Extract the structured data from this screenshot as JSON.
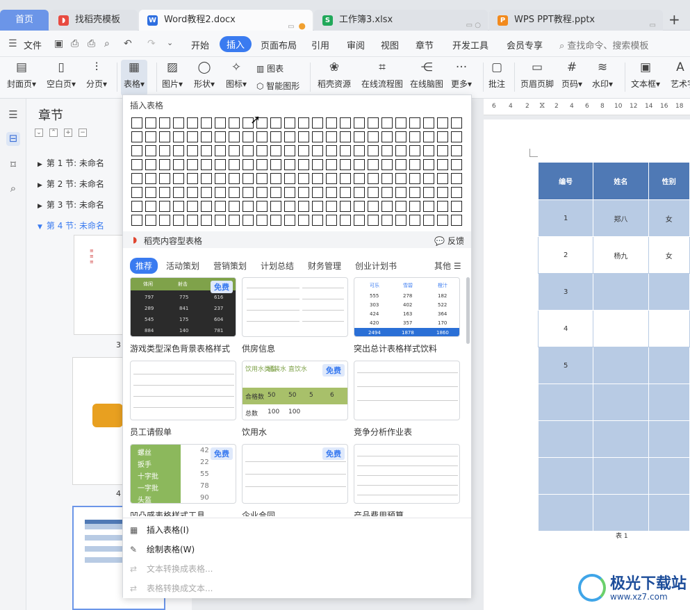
{
  "tabs": {
    "home": "首页",
    "items": [
      {
        "label": "找稻壳模板",
        "icon": "docer-icon"
      },
      {
        "label": "Word教程2.docx",
        "icon": "word-icon"
      },
      {
        "label": "工作簿3.xlsx",
        "icon": "sheet-icon"
      },
      {
        "label": "WPS PPT教程.pptx",
        "icon": "ppt-icon"
      }
    ],
    "new_tab": "+"
  },
  "menu": {
    "file": "文件",
    "items": [
      "开始",
      "插入",
      "页面布局",
      "引用",
      "审阅",
      "视图",
      "章节",
      "开发工具",
      "会员专享"
    ],
    "active": "插入",
    "search": "查找命令、搜索模板"
  },
  "ribbon": {
    "cover": "封面页",
    "blank": "空白页",
    "pagebreak": "分页",
    "table": "表格",
    "picture": "图片",
    "shape": "形状",
    "icon": "图标",
    "chart": "图表",
    "smart": "智能图形",
    "resource": "稻壳资源",
    "flow": "在线流程图",
    "mind": "在线脑图",
    "more": "更多",
    "comment": "批注",
    "header": "页眉页脚",
    "pagenum": "页码",
    "watermark": "水印",
    "textbox": "文本框",
    "art": "艺术字"
  },
  "nav": {
    "title": "章节",
    "items": [
      "第 1 节: 未命名",
      "第 2 节: 未命名",
      "第 3 节: 未命名",
      "第 4 节: 未命名"
    ],
    "thumb_nums": [
      "3",
      "4"
    ]
  },
  "dropdown": {
    "insert_table": "插入表格",
    "section": "稻壳内容型表格",
    "feedback": "反馈",
    "categories": [
      "推荐",
      "活动策划",
      "营销策划",
      "计划总结",
      "财务管理",
      "创业计划书",
      "其他"
    ],
    "free": "免费",
    "templates": [
      {
        "name": "游戏类型深色背景表格样式"
      },
      {
        "name": "供房信息"
      },
      {
        "name": "突出总计表格样式饮料"
      },
      {
        "name": "员工请假单"
      },
      {
        "name": "饮用水"
      },
      {
        "name": "竞争分析作业表"
      },
      {
        "name": "凹凸感表格样式工具"
      },
      {
        "name": "企业合同"
      },
      {
        "name": "产品费用预算"
      }
    ],
    "menu": {
      "insert": "插入表格(I)",
      "draw": "绘制表格(W)",
      "text_to_table": "文本转换成表格...",
      "table_to_text": "表格转换成文本..."
    },
    "tpl1": {
      "headers": [
        "体闲",
        "射击",
        "动作"
      ],
      "rows": [
        [
          "797",
          "775",
          "616"
        ],
        [
          "289",
          "841",
          "237"
        ],
        [
          "545",
          "175",
          "604"
        ],
        [
          "884",
          "140",
          "781"
        ]
      ]
    },
    "tpl3": {
      "headers": [
        "可乐",
        "雪碧",
        "橙汁"
      ],
      "rows": [
        [
          "555",
          "278",
          "182"
        ],
        [
          "303",
          "402",
          "522"
        ],
        [
          "424",
          "163",
          "364"
        ],
        [
          "420",
          "357",
          "170"
        ]
      ],
      "total": [
        "2494",
        "1878",
        "1860"
      ]
    },
    "tpl5": {
      "row1": [
        "饮用水类型",
        "桶装水",
        "直饮水"
      ],
      "row2": [
        "合格数",
        "50",
        "50",
        "5",
        "6"
      ],
      "row3": [
        "总数",
        "100",
        "100"
      ]
    },
    "tpl7": {
      "rows": [
        [
          "螺丝",
          "42"
        ],
        [
          "扳手",
          "22"
        ],
        [
          "十字批",
          "55"
        ],
        [
          "一字批",
          "78"
        ],
        [
          "头盔",
          "90"
        ]
      ]
    }
  },
  "ruler": [
    "6",
    "4",
    "2",
    "2",
    "4",
    "6",
    "8",
    "10",
    "12",
    "14",
    "16",
    "18"
  ],
  "doc_table": {
    "headers": [
      "编号",
      "姓名",
      "性别"
    ],
    "rows": [
      [
        "1",
        "郑八",
        "女"
      ],
      [
        "2",
        "杨九",
        "女"
      ],
      [
        "3",
        "",
        ""
      ],
      [
        "4",
        "",
        ""
      ],
      [
        "5",
        "",
        ""
      ],
      [
        "",
        "",
        ""
      ],
      [
        "",
        "",
        ""
      ],
      [
        "",
        "",
        ""
      ],
      [
        "",
        "",
        ""
      ]
    ],
    "caption": "表 1"
  },
  "watermark": {
    "name": "极光下载站",
    "url": "www.xz7.com"
  }
}
